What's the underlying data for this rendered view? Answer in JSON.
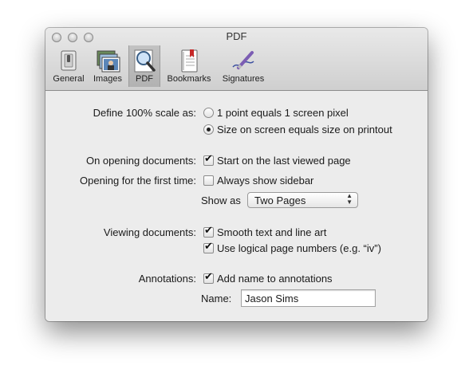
{
  "window": {
    "title": "PDF"
  },
  "toolbar": {
    "items": [
      {
        "label": "General",
        "icon": "switch-icon"
      },
      {
        "label": "Images",
        "icon": "photos-icon"
      },
      {
        "label": "PDF",
        "icon": "magnifier-icon",
        "selected": true
      },
      {
        "label": "Bookmarks",
        "icon": "bookmarks-icon"
      },
      {
        "label": "Signatures",
        "icon": "pen-icon"
      }
    ]
  },
  "scale": {
    "label": "Define 100% scale as:",
    "options": [
      {
        "label": "1 point equals 1 screen pixel",
        "selected": false
      },
      {
        "label": "Size on screen equals size on printout",
        "selected": true
      }
    ]
  },
  "opening": {
    "label": "On opening documents:",
    "option": {
      "label": "Start on the last viewed page",
      "checked": true
    }
  },
  "first_time": {
    "label": "Opening for the first time:",
    "option": {
      "label": "Always show sidebar",
      "checked": false
    },
    "show_as_label": "Show as",
    "show_as_value": "Two Pages"
  },
  "viewing": {
    "label": "Viewing documents:",
    "options": [
      {
        "label": "Smooth text and line art",
        "checked": true
      },
      {
        "label": "Use logical page numbers (e.g. “iv”)",
        "checked": true
      }
    ]
  },
  "annotations": {
    "label": "Annotations:",
    "option": {
      "label": "Add name to annotations",
      "checked": true
    },
    "name_label": "Name:",
    "name_value": "Jason Sims"
  }
}
